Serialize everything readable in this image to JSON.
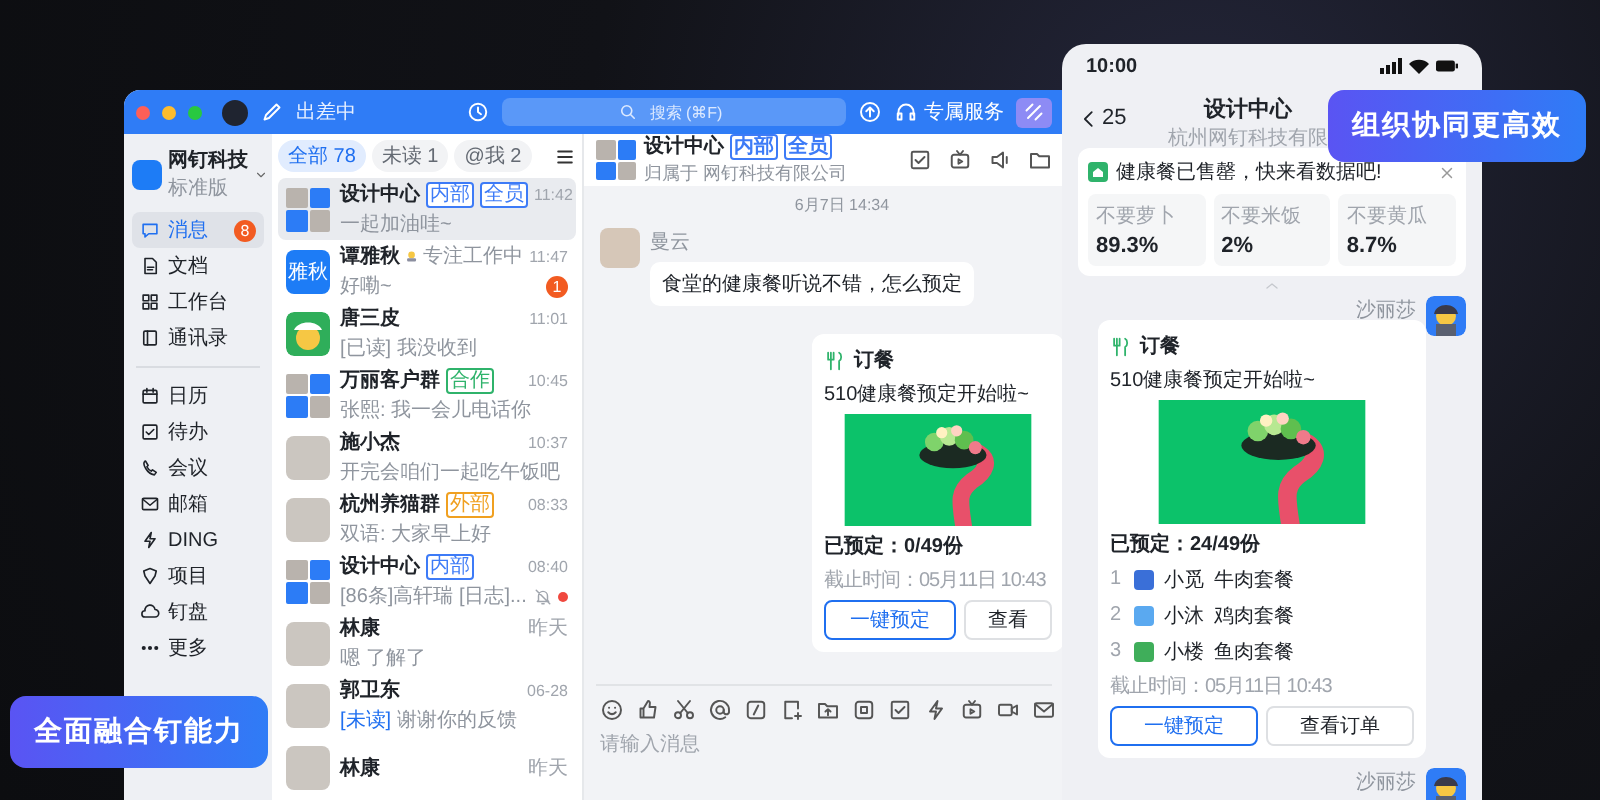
{
  "desktop": {
    "titlebar": {
      "status": "出差中",
      "search_placeholder": "搜索 (⌘F)",
      "service": "专属服务"
    },
    "org": {
      "name": "网钉科技",
      "plan": "标准版"
    },
    "nav_groups": [
      [
        {
          "label": "消息",
          "selected": true,
          "badge": "8"
        },
        {
          "label": "文档",
          "selected": false
        },
        {
          "label": "工作台",
          "selected": false
        },
        {
          "label": "通讯录",
          "selected": false
        }
      ],
      [
        {
          "label": "日历",
          "selected": false
        },
        {
          "label": "待办",
          "selected": false
        },
        {
          "label": "会议",
          "selected": false
        },
        {
          "label": "邮箱",
          "selected": false
        },
        {
          "label": "DING",
          "selected": false
        },
        {
          "label": "项目",
          "selected": false
        },
        {
          "label": "钉盘",
          "selected": false
        },
        {
          "label": "更多",
          "selected": false
        }
      ]
    ],
    "filters": [
      {
        "label": "全部 78",
        "selected": true
      },
      {
        "label": "未读 1",
        "selected": false
      },
      {
        "label": "@我 2",
        "selected": false
      }
    ],
    "chats": [
      {
        "name": "设计中心",
        "kind": "group",
        "tags": [
          {
            "label": "内部",
            "color": "#3d7bf7"
          },
          {
            "label": "全员",
            "color": "#3d7bf7"
          }
        ],
        "time": "11:42",
        "preview": "一起加油哇~",
        "selected": true,
        "muted": false,
        "unread_dot": false
      },
      {
        "name": "谭雅秋",
        "kind": "text",
        "avatar_text": "雅秋",
        "status": "专注工作中",
        "time": "11:47",
        "preview": "好嘞~",
        "badge": "1",
        "selected": false,
        "muted": false,
        "unread_dot": false
      },
      {
        "name": "唐三皮",
        "kind": "cartoon",
        "time": "11:01",
        "receipt": {
          "label": "[已读]",
          "read": true
        },
        "preview": "我没收到",
        "selected": false,
        "muted": false,
        "unread_dot": false
      },
      {
        "name": "万丽客户群",
        "kind": "group",
        "tags": [
          {
            "label": "合作",
            "color": "#2fb36b"
          }
        ],
        "time": "10:45",
        "preview": "张熙: 我一会儿电话你",
        "selected": false,
        "muted": false,
        "unread_dot": false
      },
      {
        "name": "施小杰",
        "kind": "photo",
        "time": "10:37",
        "preview": "开完会咱们一起吃午饭吧",
        "selected": false,
        "muted": false,
        "unread_dot": false
      },
      {
        "name": "杭州养猫群",
        "kind": "photo",
        "tags": [
          {
            "label": "外部",
            "color": "#f0a020"
          }
        ],
        "time": "08:33",
        "preview": "双语: 大家早上好",
        "selected": false,
        "muted": false,
        "unread_dot": false
      },
      {
        "name": "设计中心",
        "kind": "group",
        "tags": [
          {
            "label": "内部",
            "color": "#3d7bf7"
          }
        ],
        "time": "08:40",
        "preview": "[86条]高轩瑞 [日志]...",
        "selected": false,
        "muted": true,
        "unread_dot": true
      },
      {
        "name": "林康",
        "kind": "photo",
        "time": "昨天",
        "preview": "嗯 了解了",
        "selected": false,
        "muted": false,
        "unread_dot": false
      },
      {
        "name": "郭卫东",
        "kind": "photo",
        "time": "06-28",
        "receipt": {
          "label": "[未读]",
          "read": false
        },
        "preview": "谢谢你的反馈",
        "selected": false,
        "muted": false,
        "unread_dot": false
      },
      {
        "name": "林康",
        "kind": "photo",
        "time": "昨天",
        "selected": false,
        "muted": false,
        "unread_dot": false
      }
    ],
    "conversation": {
      "title": "设计中心",
      "tags": [
        {
          "label": "内部",
          "color": "#3d7bf7"
        },
        {
          "label": "全员",
          "color": "#3d7bf7"
        }
      ],
      "subtitle": "归属于 网钉科技有限公司",
      "date": "6月7日 14:34",
      "message": {
        "sender": "曼云",
        "text": "食堂的健康餐听说不错，怎么预定"
      },
      "card": {
        "title": "订餐",
        "text": "510健康餐预定开始啦~",
        "booked": "已预定：0/49份",
        "deadline": "截止时间：05月11日 10:43",
        "buttons": [
          {
            "label": "一键预定",
            "primary": true
          },
          {
            "label": "查看",
            "primary": false
          }
        ]
      },
      "input_placeholder": "请输入消息"
    }
  },
  "phone": {
    "time": "10:00",
    "back": "25",
    "title": "设计中心",
    "subtitle": "杭州网钉科技有限",
    "notice": {
      "text": "健康餐已售罄，快来看数据吧!",
      "stats": [
        {
          "label": "不要萝卜",
          "value": "89.3%"
        },
        {
          "label": "不要米饭",
          "value": "2%"
        },
        {
          "label": "不要黄瓜",
          "value": "8.7%"
        }
      ]
    },
    "sender": "沙丽莎",
    "card": {
      "title": "订餐",
      "text": "510健康餐预定开始啦~",
      "booked": "已预定：24/49份",
      "orders": [
        {
          "rank": "1",
          "name": "小觅",
          "meal": "牛肉套餐",
          "color": "#3a6fd8"
        },
        {
          "rank": "2",
          "name": "小沐",
          "meal": "鸡肉套餐",
          "color": "#5aa9f0"
        },
        {
          "rank": "3",
          "name": "小楼",
          "meal": "鱼肉套餐",
          "color": "#3fae5a"
        }
      ],
      "deadline": "截止时间：05月11日 10:43",
      "buttons": [
        {
          "label": "一键预定",
          "primary": true
        },
        {
          "label": "查看订单",
          "primary": false
        }
      ]
    },
    "next_sender": "沙丽莎"
  },
  "callouts": {
    "top_right": "组织协同更高效",
    "bottom_left": "全面融合钉能力"
  }
}
